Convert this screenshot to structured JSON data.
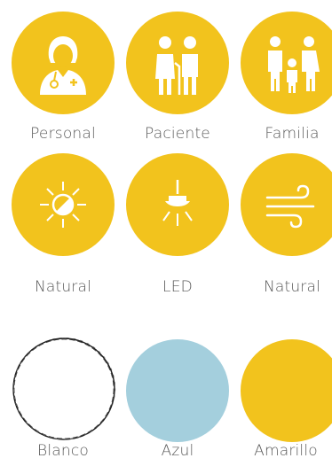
{
  "colors": {
    "yellow": "#F2C31D",
    "blue": "#A4CFDD",
    "white": "#FFFFFF",
    "label_gray": "#585858"
  },
  "rows": [
    {
      "items": [
        {
          "label": "Personal",
          "icon": "doctor-icon",
          "color": "yellow"
        },
        {
          "label": "Paciente",
          "icon": "elderly-couple-icon",
          "color": "yellow"
        },
        {
          "label": "Familia",
          "icon": "family-icon",
          "color": "yellow"
        }
      ]
    },
    {
      "items": [
        {
          "label": "Natural",
          "icon": "sun-icon",
          "color": "yellow"
        },
        {
          "label": "LED",
          "icon": "ceiling-lamp-icon",
          "color": "yellow"
        },
        {
          "label": "Natural",
          "icon": "wind-icon",
          "color": "yellow"
        }
      ]
    },
    {
      "items": [
        {
          "label": "Blanco",
          "icon": "white-swatch",
          "color": "white"
        },
        {
          "label": "Azul",
          "icon": "blue-swatch",
          "color": "blue"
        },
        {
          "label": "Amarillo",
          "icon": "yellow-swatch",
          "color": "yellow"
        }
      ]
    }
  ]
}
